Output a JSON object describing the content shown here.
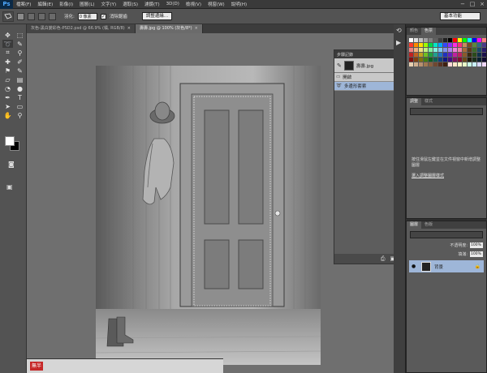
{
  "app": {
    "logo_text": "Ps"
  },
  "menubar": {
    "items": [
      "檔案(F)",
      "編輯(E)",
      "影像(I)",
      "圖層(L)",
      "文字(Y)",
      "選取(S)",
      "濾鏡(T)",
      "3D(D)",
      "檢視(V)",
      "視窗(W)",
      "說明(H)"
    ],
    "window_buttons": [
      "−",
      "□",
      "×"
    ]
  },
  "optionsbar": {
    "feather_label": "羽化:",
    "feather_value": "0 像素",
    "antialias_checked": "✓",
    "antialias_label": "消除鋸齒",
    "refine_button": "調整邊緣...",
    "workspace": "基本功能"
  },
  "tabs": [
    {
      "label": "灰色-黑白變彩色-PSD2.psd @ 66.9% (橘, RGB/8)",
      "close": "×"
    },
    {
      "label": "壽壽.jpg @ 100% (灰色/8*)",
      "close": "×"
    }
  ],
  "history": {
    "title": "步驟記錄",
    "close": "×",
    "snapshot_label": "壽壽.jpg",
    "rows": [
      {
        "label": "開啟"
      },
      {
        "label": "多邊形套索"
      }
    ],
    "footer_icons": [
      "⎙",
      "▣",
      "🗑"
    ]
  },
  "swatches_panel": {
    "tabs": [
      "顏色",
      "色票"
    ],
    "colors": [
      "#ffffff",
      "#e0e0e0",
      "#c0c0c0",
      "#a0a0a0",
      "#808080",
      "#606060",
      "#404040",
      "#202020",
      "#000000",
      "#ff0000",
      "#ffff00",
      "#00ff00",
      "#00ffff",
      "#0000ff",
      "#ff00ff",
      "#ff8080",
      "#ff3a2c",
      "#ff8a00",
      "#ffe100",
      "#9cff00",
      "#00d64b",
      "#00e6c8",
      "#00a8ff",
      "#3446ff",
      "#8a2cff",
      "#ff2ce1",
      "#ff2c7d",
      "#c88c5a",
      "#7a4a22",
      "#5a8a3a",
      "#2c6a8a",
      "#4a3a8a",
      "#f08080",
      "#f0b080",
      "#f0e080",
      "#c0f080",
      "#80f0a0",
      "#80f0e0",
      "#80c8f0",
      "#8090f0",
      "#b080f0",
      "#f080d8",
      "#f080a8",
      "#a86a3a",
      "#5a3a1a",
      "#3a6a2a",
      "#1a4a6a",
      "#2a1a6a",
      "#c02020",
      "#c06020",
      "#c0a020",
      "#70c020",
      "#20a040",
      "#20a090",
      "#2070c0",
      "#2030c0",
      "#6020c0",
      "#c020a0",
      "#c02060",
      "#8a5a2a",
      "#3a2a10",
      "#2a4a1a",
      "#10304a",
      "#1a104a",
      "#801010",
      "#804010",
      "#807010",
      "#408010",
      "#106020",
      "#106050",
      "#104080",
      "#101880",
      "#401080",
      "#801060",
      "#801030",
      "#6a4a1a",
      "#201a0a",
      "#1a301a",
      "#0a2030",
      "#100a30",
      "#e8d0b0",
      "#d0b090",
      "#b89070",
      "#a07850",
      "#886040",
      "#704830",
      "#583020",
      "#402010",
      "#ffd8d8",
      "#ffe8c8",
      "#fff8c8",
      "#e8ffc8",
      "#c8ffe8",
      "#c8f0ff",
      "#d8d8ff",
      "#f0d8ff"
    ]
  },
  "adjust_panel": {
    "tabs": [
      "調整",
      "樣式"
    ],
    "message": "按住滑鼠左鍵並在文件視窗中新增調整圖層",
    "link": "選入調整圖層樣式"
  },
  "layers_panel": {
    "tabs": [
      "圖層",
      "色版"
    ],
    "opacity_label": "不透明度:",
    "opacity_value": "100%",
    "fill_label": "填滿:",
    "fill_value": "100%",
    "layer_name": "背景",
    "eye": "●",
    "lock": "🔒"
  },
  "status": {
    "tag": "無半"
  }
}
